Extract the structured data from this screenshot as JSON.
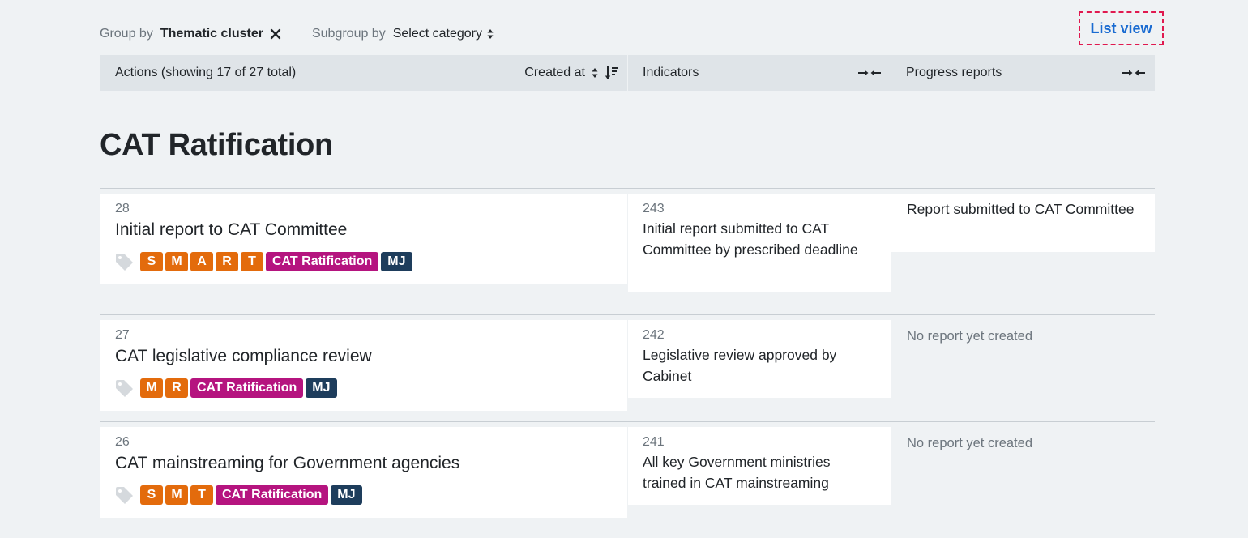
{
  "toolbar": {
    "group_label": "Group by",
    "group_value": "Thematic cluster",
    "subgroup_label": "Subgroup by",
    "subgroup_value": "Select category",
    "list_view": "List view"
  },
  "header": {
    "actions_label": "Actions (showing 17 of 27 total)",
    "created_at": "Created at",
    "indicators": "Indicators",
    "progress_reports": "Progress reports"
  },
  "group": {
    "title": "CAT Ratification",
    "rows": [
      {
        "id": "28",
        "title": "Initial report to CAT Committee",
        "smart": [
          "S",
          "M",
          "A",
          "R",
          "T"
        ],
        "category": "CAT Ratification",
        "user": "MJ",
        "indicator_id": "243",
        "indicator_text": "Initial report submitted to CAT Committee by prescribed deadline",
        "report": "Report submitted to CAT Committee",
        "report_empty": false
      },
      {
        "id": "27",
        "title": "CAT legislative compliance review",
        "smart": [
          "M",
          "R"
        ],
        "category": "CAT Ratification",
        "user": "MJ",
        "indicator_id": "242",
        "indicator_text": "Legislative review approved by Cabinet",
        "report": "No report yet created",
        "report_empty": true
      },
      {
        "id": "26",
        "title": "CAT mainstreaming for Government agencies",
        "smart": [
          "S",
          "M",
          "T"
        ],
        "category": "CAT Ratification",
        "user": "MJ",
        "indicator_id": "241",
        "indicator_text": "All key Government ministries trained in CAT mainstreaming",
        "report": "No report yet created",
        "report_empty": true
      }
    ]
  },
  "colors": {
    "smart": "#e36b0c",
    "category": "#b5147f",
    "user": "#1e3d5c",
    "link": "#1a6bd1"
  }
}
